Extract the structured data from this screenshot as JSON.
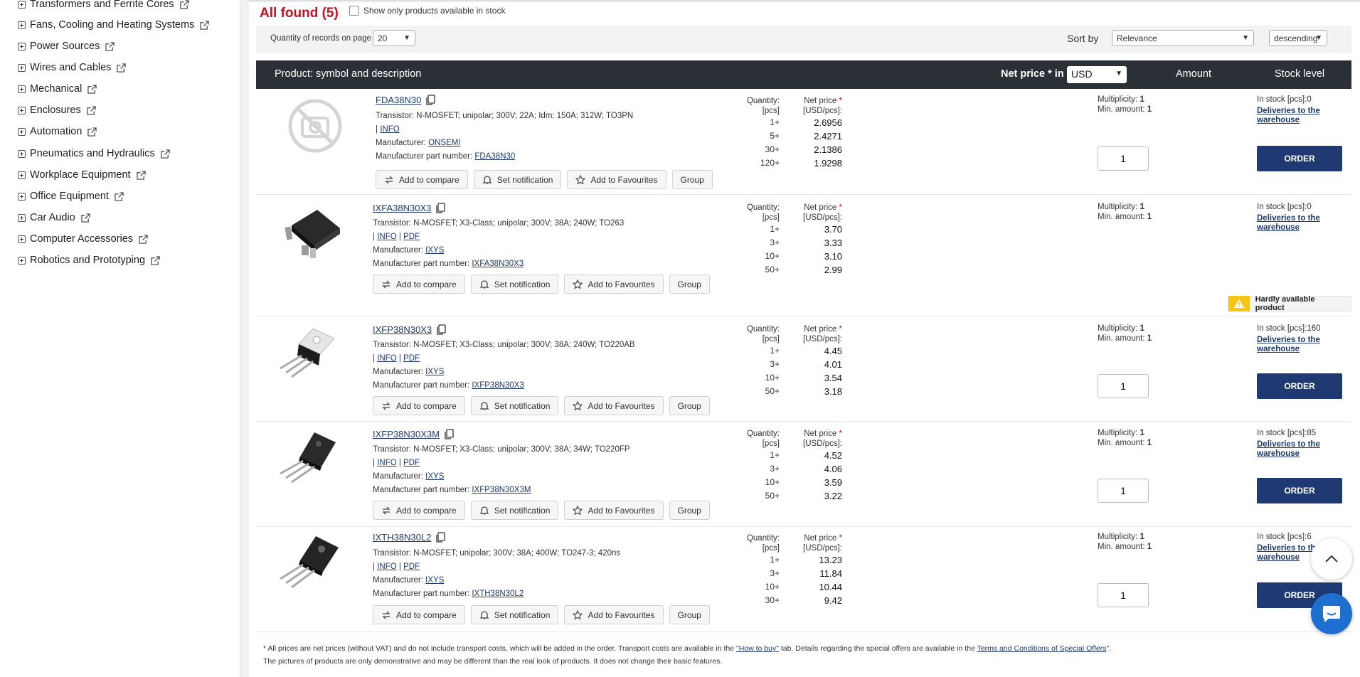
{
  "sidebar": {
    "items": [
      {
        "label": "Transformers and Ferrite Cores"
      },
      {
        "label": "Fans, Cooling and Heating Systems"
      },
      {
        "label": "Power Sources"
      },
      {
        "label": "Wires and Cables"
      },
      {
        "label": "Mechanical"
      },
      {
        "label": "Enclosures"
      },
      {
        "label": "Automation"
      },
      {
        "label": "Pneumatics and Hydraulics"
      },
      {
        "label": "Workplace Equipment"
      },
      {
        "label": "Office Equipment"
      },
      {
        "label": "Car Audio"
      },
      {
        "label": "Computer Accessories"
      },
      {
        "label": "Robotics and Prototyping"
      }
    ]
  },
  "results": {
    "found_label": "All found (5)",
    "stock_only_label": "Show only products available in stock"
  },
  "toolbar": {
    "qty_label": "Quantity of records on page",
    "qty_value": "20",
    "sort_label": "Sort by",
    "sort_value": "Relevance",
    "order_value": "descending"
  },
  "table_header": {
    "product": "Product: symbol and description",
    "net_price_in": "Net price * in",
    "currency": "USD",
    "amount": "Amount",
    "stock_level": "Stock level"
  },
  "labels": {
    "quantity": "Quantity:",
    "pcs": "[pcs]",
    "net_price": "Net price",
    "usd_pcs": "[USD/pcs]:",
    "star": "*",
    "manufacturer": "Manufacturer:",
    "mpn": "Manufacturer part number:",
    "multiplicity": "Multiplicity:",
    "min_amount": "Min. amount:",
    "in_stock": "In stock [pcs]:",
    "deliveries": "Deliveries to the warehouse",
    "order": "ORDER",
    "add_compare": "Add to compare",
    "set_notification": "Set notification",
    "add_favourites": "Add to Favourites",
    "group": "Group",
    "info": "INFO",
    "pdf": "PDF",
    "sep": "|",
    "hardly_available": "Hardly available product"
  },
  "products": [
    {
      "symbol": "FDA38N30",
      "description": "Transistor: N-MOSFET; unipolar; 300V; 22A; Idm: 150A; 312W; TO3PN",
      "manufacturer": "ONSEMI",
      "mpn": "FDA38N30",
      "tiers": [
        "1+",
        "5+",
        "30+",
        "120+"
      ],
      "prices": [
        "2.6956",
        "2.4271",
        "2.1386",
        "1.9298"
      ],
      "multiplicity": "1",
      "min_amount": "1",
      "amount": "1",
      "stock": "0"
    },
    {
      "symbol": "IXFA38N30X3",
      "description": "Transistor: N-MOSFET; X3-Class; unipolar; 300V; 38A; 240W; TO263",
      "manufacturer": "IXYS",
      "mpn": "IXFA38N30X3",
      "tiers": [
        "1+",
        "3+",
        "10+",
        "50+"
      ],
      "prices": [
        "3.70",
        "3.33",
        "3.10",
        "2.99"
      ],
      "multiplicity": "1",
      "min_amount": "1",
      "stock": "0"
    },
    {
      "symbol": "IXFP38N30X3",
      "description": "Transistor: N-MOSFET; X3-Class; unipolar; 300V; 38A; 240W; TO220AB",
      "manufacturer": "IXYS",
      "mpn": "IXFP38N30X3",
      "tiers": [
        "1+",
        "3+",
        "10+",
        "50+"
      ],
      "prices": [
        "4.45",
        "4.01",
        "3.54",
        "3.18"
      ],
      "multiplicity": "1",
      "min_amount": "1",
      "amount": "1",
      "stock": "160"
    },
    {
      "symbol": "IXFP38N30X3M",
      "description": "Transistor: N-MOSFET; X3-Class; unipolar; 300V; 38A; 34W; TO220FP",
      "manufacturer": "IXYS",
      "mpn": "IXFP38N30X3M",
      "tiers": [
        "1+",
        "3+",
        "10+",
        "50+"
      ],
      "prices": [
        "4.52",
        "4.06",
        "3.59",
        "3.22"
      ],
      "multiplicity": "1",
      "min_amount": "1",
      "amount": "1",
      "stock": "85"
    },
    {
      "symbol": "IXTH38N30L2",
      "description": "Transistor: N-MOSFET; unipolar; 300V; 38A; 400W; TO247-3; 420ns",
      "manufacturer": "IXYS",
      "mpn": "IXTH38N30L2",
      "tiers": [
        "1+",
        "3+",
        "10+",
        "30+"
      ],
      "prices": [
        "13.23",
        "11.84",
        "10.44",
        "9.42"
      ],
      "multiplicity": "1",
      "min_amount": "1",
      "amount": "1",
      "stock": "6"
    }
  ],
  "footer": {
    "line1_a": "* All prices are net prices (without VAT) and do not include transport costs, which will be added in the order. Transport costs are available in the ",
    "line1_link1": "\"How to buy\"",
    "line1_b": " tab. Details regarding the special offers are available in the ",
    "line1_link2": "Terms and Conditions of Special Offers",
    "line1_c": "\".",
    "line2": "The pictures of products are only demonstrative and may be different than the real look of products. It does not change their basic features."
  },
  "colors": {
    "accent_red": "#c1121f",
    "header_dark": "#2b3036",
    "order_blue": "#1f3a73",
    "warn_yellow": "#f5c518",
    "chat_blue": "#1f6fd1"
  }
}
